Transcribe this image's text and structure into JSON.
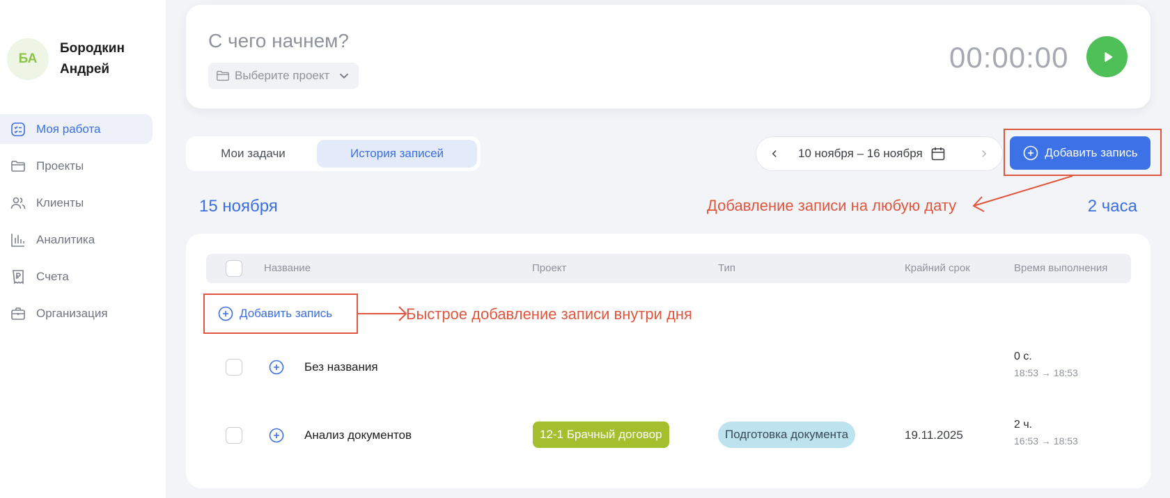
{
  "user": {
    "initials": "БА",
    "name": "Бородкин Андрей"
  },
  "nav": [
    {
      "label": "Моя работа",
      "icon": "tasks-icon",
      "active": true
    },
    {
      "label": "Проекты",
      "icon": "folder-icon"
    },
    {
      "label": "Клиенты",
      "icon": "users-icon"
    },
    {
      "label": "Аналитика",
      "icon": "chart-icon"
    },
    {
      "label": "Счета",
      "icon": "invoice-icon"
    },
    {
      "label": "Организация",
      "icon": "briefcase-icon"
    }
  ],
  "timer": {
    "prompt": "С чего начнем?",
    "project_placeholder": "Выберите проект",
    "time": "00:00:00"
  },
  "tabs": [
    {
      "label": "Мои задачи"
    },
    {
      "label": "История записей",
      "active": true
    }
  ],
  "date_range": {
    "label": "10 ноября – 16 ноября"
  },
  "add_button": {
    "label": "Добавить запись"
  },
  "day": {
    "title": "15 ноября",
    "total": "2 часа"
  },
  "annotations": {
    "top": "Добавление записи на любую дату",
    "inline": "Быстрое добавление записи внутри дня"
  },
  "table": {
    "columns": {
      "name": "Название",
      "project": "Проект",
      "type": "Тип",
      "deadline": "Крайний срок",
      "time": "Время выполнения"
    },
    "add_inline_label": "Добавить запись",
    "rows": [
      {
        "title": "Без названия",
        "project": "",
        "type": "",
        "deadline": "",
        "duration": "0 с.",
        "span": "18:53 → 18:53"
      },
      {
        "title": "Анализ документов",
        "project": "12-1 Брачный договор",
        "type": "Подготовка документа",
        "deadline": "19.11.2025",
        "duration": "2 ч.",
        "span": "16:53 → 18:53"
      }
    ]
  },
  "colors": {
    "accent": "#3d72e6",
    "play": "#4fbf58",
    "annotation": "#e0553d",
    "project_badge": "#a3bf2e",
    "type_badge": "#bde3ef"
  }
}
